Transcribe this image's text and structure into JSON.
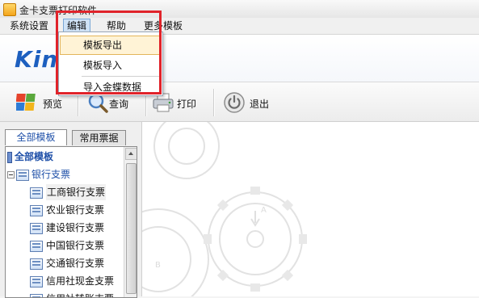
{
  "window": {
    "title": "金卡支票打印软件"
  },
  "menubar": {
    "items": [
      "系统设置",
      "编辑",
      "帮助",
      "更多模板"
    ],
    "active_index": 1
  },
  "dropdown": {
    "items": [
      "模板导出",
      "模板导入",
      "导入金蝶数据"
    ],
    "highlighted_index": 0
  },
  "banner": {
    "logo_text": "Kin"
  },
  "toolbar": {
    "preview": "预览",
    "query": "查询",
    "print": "打印",
    "exit": "退出"
  },
  "left_panel": {
    "tabs": [
      "全部模板",
      "常用票据"
    ],
    "active_tab": 0,
    "tree": {
      "root": "全部模板",
      "group": "银行支票",
      "items": [
        "工商银行支票",
        "农业银行支票",
        "建设银行支票",
        "中国银行支票",
        "交通银行支票",
        "信用社现金支票",
        "信用社转账支票"
      ]
    }
  },
  "colors": {
    "highlight_border": "#e0232a",
    "accent": "#1e4fa8"
  }
}
